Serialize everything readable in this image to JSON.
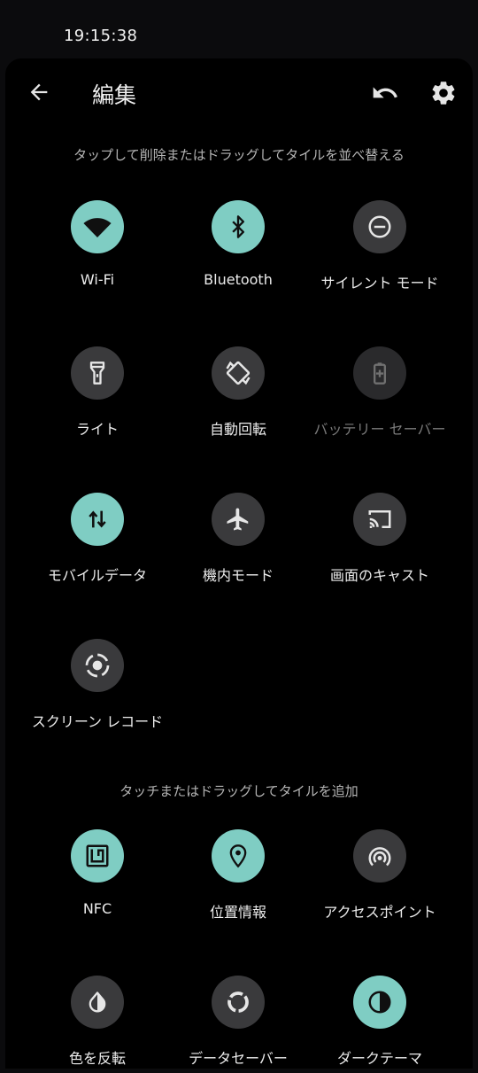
{
  "status_bar": {
    "time": "19:15:38"
  },
  "header": {
    "title": "編集"
  },
  "hint_edit": "タップして削除またはドラッグしてタイルを並べ替える",
  "hint_add": "タッチまたはドラッグしてタイルを追加",
  "active_tiles": [
    {
      "label": "Wi-Fi",
      "icon": "wifi-icon",
      "state": "on"
    },
    {
      "label": "Bluetooth",
      "icon": "bluetooth-icon",
      "state": "on"
    },
    {
      "label": "サイレント モード",
      "icon": "do-not-disturb-icon",
      "state": "off"
    },
    {
      "label": "ライト",
      "icon": "flashlight-icon",
      "state": "off"
    },
    {
      "label": "自動回転",
      "icon": "auto-rotate-icon",
      "state": "off"
    },
    {
      "label": "バッテリー セーバー",
      "icon": "battery-saver-icon",
      "state": "unavailable"
    },
    {
      "label": "モバイルデータ",
      "icon": "mobile-data-icon",
      "state": "on"
    },
    {
      "label": "機内モード",
      "icon": "airplane-icon",
      "state": "off"
    },
    {
      "label": "画面のキャスト",
      "icon": "cast-icon",
      "state": "off"
    },
    {
      "label": "スクリーン レコード",
      "icon": "screen-record-icon",
      "state": "off"
    }
  ],
  "available_tiles": [
    {
      "label": "NFC",
      "icon": "nfc-icon",
      "state": "on"
    },
    {
      "label": "位置情報",
      "icon": "location-icon",
      "state": "on"
    },
    {
      "label": "アクセスポイント",
      "icon": "hotspot-icon",
      "state": "off"
    },
    {
      "label": "色を反転",
      "icon": "invert-colors-icon",
      "state": "off"
    },
    {
      "label": "データセーバー",
      "icon": "data-saver-icon",
      "state": "off"
    },
    {
      "label": "ダークテーマ",
      "icon": "dark-theme-icon",
      "state": "on"
    }
  ],
  "colors": {
    "accent": "#7fcdc3",
    "tile_off": "#3a3a3c",
    "background": "#000000"
  }
}
